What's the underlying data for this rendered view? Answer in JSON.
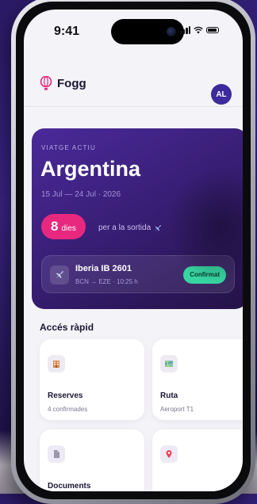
{
  "status_bar": {
    "time": "9:41"
  },
  "header": {
    "app_name": "Fogg",
    "avatar_initials": "AL"
  },
  "trip": {
    "eyebrow": "VIATGE ACTIU",
    "destination": "Argentina",
    "dates": "15 Jul — 24 Jul · 2026",
    "days_count": "8",
    "days_label": "dies",
    "days_text": "per a la sortida",
    "flight": {
      "name": "Iberia IB 2601",
      "route": "BCN → EZE · 10:25 h",
      "status": "Confirmat"
    }
  },
  "quick_access": {
    "title": "Accés ràpid",
    "items": [
      {
        "title": "Reserves",
        "subtitle": "4 confirmades",
        "icon": "hotel-icon"
      },
      {
        "title": "Ruta",
        "subtitle": "Aeroport T1",
        "icon": "map-icon"
      },
      {
        "title": "Documents",
        "subtitle": "",
        "icon": "document-icon"
      },
      {
        "title": "",
        "subtitle": "",
        "icon": "pin-icon"
      }
    ]
  },
  "colors": {
    "accent": "#3d2a9c",
    "pill": "#e8287f",
    "confirm": "#37d6a0",
    "card_start": "#4a2a9a",
    "card_end": "#241247"
  }
}
